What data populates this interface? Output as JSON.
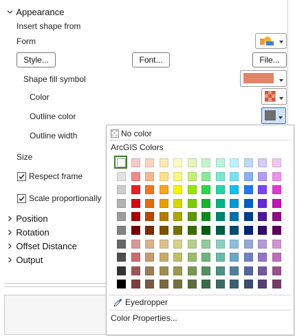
{
  "sections": {
    "appearance": "Appearance",
    "position": "Position",
    "rotation": "Rotation",
    "offset_distance": "Offset Distance",
    "output": "Output"
  },
  "labels": {
    "insert_shape_from": "Insert shape from",
    "form": "Form",
    "shape_fill_symbol": "Shape fill symbol",
    "color": "Color",
    "outline_color": "Outline color",
    "outline_width": "Outline width",
    "size": "Size"
  },
  "buttons": {
    "style": "Style...",
    "font": "Font...",
    "file": "File..."
  },
  "checkboxes": {
    "respect_frame": {
      "label": "Respect frame",
      "checked": true
    },
    "scale_proportionally": {
      "label": "Scale proportionally",
      "checked": true
    }
  },
  "colors": {
    "shape_fill": "#e0846a",
    "outline": "#6e6e6e",
    "selection": "#3e7d2a"
  },
  "popup": {
    "no_color": "No color",
    "palette_title": "ArcGIS Colors",
    "eyedropper": "Eyedropper",
    "color_properties": "Color Properties...",
    "palette": [
      [
        "#ffffff",
        "#f6c8cc",
        "#f7d6bd",
        "#f8e8bb",
        "#fafac3",
        "#e3f6bd",
        "#c8f3cd",
        "#bdf3e3",
        "#bdf2fb",
        "#c0d8f8",
        "#d6ccf7",
        "#f0c8f2"
      ],
      [
        "#e1e1e1",
        "#f3888c",
        "#f6b890",
        "#fde18a",
        "#f8f77e",
        "#c6f07a",
        "#8ae99b",
        "#7de8d0",
        "#7ae1f5",
        "#88b2f3",
        "#b39cf2",
        "#ee92ea"
      ],
      [
        "#cccccc",
        "#ec1d25",
        "#f7751d",
        "#f5a623",
        "#f4f400",
        "#94e800",
        "#2fd64a",
        "#25d5a6",
        "#14bff0",
        "#1e78f0",
        "#7e45f0",
        "#df3ad5"
      ],
      [
        "#b2b2b2",
        "#d10b12",
        "#e36c09",
        "#e5a000",
        "#d7d700",
        "#7ecc00",
        "#18b331",
        "#00b387",
        "#0098d7",
        "#0060c6",
        "#6329d6",
        "#c414b3"
      ],
      [
        "#9c9c9c",
        "#a80000",
        "#b84600",
        "#b37d00",
        "#a8a800",
        "#5c9900",
        "#0e8a1d",
        "#00876a",
        "#0070a8",
        "#003f8a",
        "#4c1a99",
        "#8c0d87"
      ],
      [
        "#828282",
        "#730000",
        "#7a2d00",
        "#7a5200",
        "#737300",
        "#3d6b00",
        "#005c12",
        "#005c48",
        "#004c73",
        "#002673",
        "#330c66",
        "#5c0059"
      ],
      [
        "#686868",
        "#d69a9a",
        "#d9b18c",
        "#d8c18c",
        "#d3d38e",
        "#b5cf8c",
        "#94c99e",
        "#8ecfc0",
        "#8ebfd9",
        "#94a8d6",
        "#b29ad6",
        "#d196cf"
      ],
      [
        "#4e4e4e",
        "#c86d6d",
        "#c89b6c",
        "#c8ab6c",
        "#c0c06a",
        "#97bc6a",
        "#6eb47d",
        "#6ab9a6",
        "#6aa8c8",
        "#6d84c4",
        "#9574c4",
        "#c06dbd"
      ],
      [
        "#343434",
        "#9e5656",
        "#9e7a56",
        "#9e8c56",
        "#9a9a52",
        "#7a9652",
        "#558e62",
        "#528f80",
        "#52809a",
        "#54689a",
        "#73589a",
        "#97528f"
      ],
      [
        "#000000",
        "#7a3f3f",
        "#7a5a3f",
        "#7a6a3f",
        "#73733d",
        "#5b703d",
        "#3d6b48",
        "#3d6b5f",
        "#3d5f73",
        "#3f4d73",
        "#563f73",
        "#733d6b"
      ]
    ]
  }
}
